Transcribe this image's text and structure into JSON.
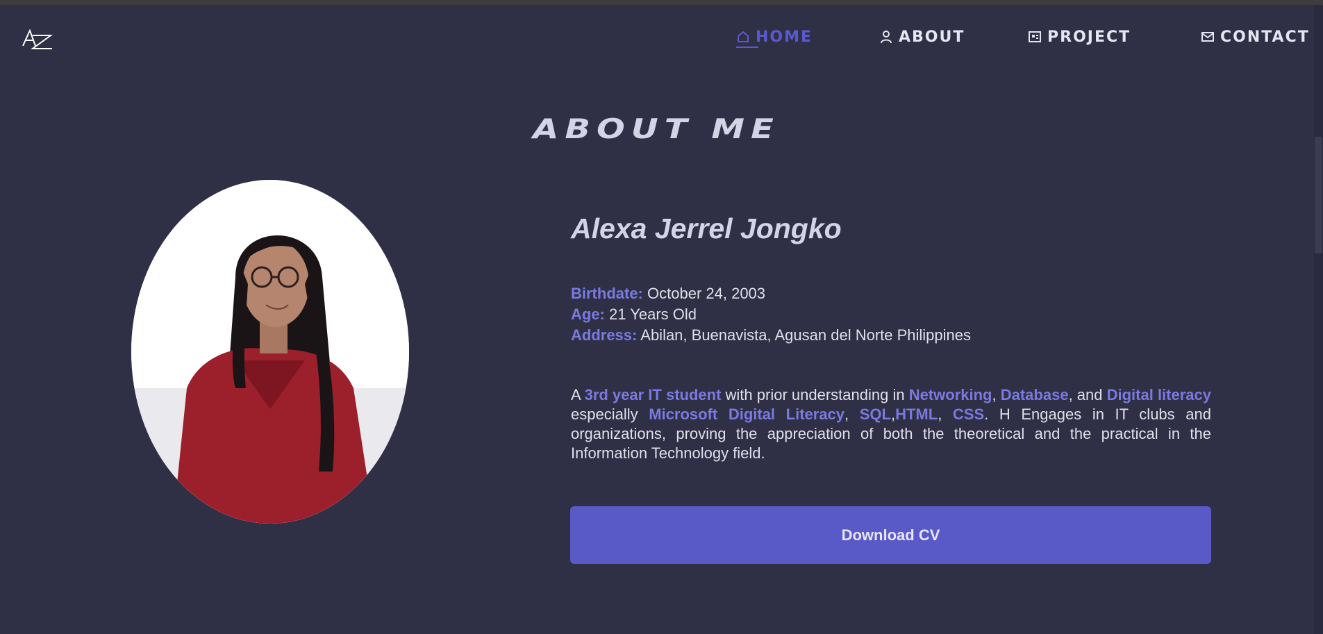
{
  "logo": {
    "text": "AZ"
  },
  "nav": {
    "items": [
      {
        "label": "HOME",
        "icon": "home-icon",
        "active": true
      },
      {
        "label": "ABOUT",
        "icon": "user-icon",
        "active": false
      },
      {
        "label": "PROJECT",
        "icon": "project-icon",
        "active": false
      },
      {
        "label": "CONTACT",
        "icon": "mail-icon",
        "active": false
      }
    ]
  },
  "section": {
    "title": "ABOUT ME"
  },
  "profile": {
    "name": "Alexa Jerrel Jongko",
    "birthdate_label": "Birthdate:",
    "birthdate": "October 24, 2003",
    "age_label": "Age:",
    "age": "21 Years Old",
    "address_label": "Address:",
    "address": "Abilan, Buenavista, Agusan del Norte Philippines"
  },
  "bio": {
    "p1": "A ",
    "h1": "3rd year IT student",
    "p2": " with prior understanding in ",
    "h2": "Networking",
    "p3": ", ",
    "h3": "Database",
    "p4": ", and ",
    "h4": "Digital literacy",
    "p5": " especially ",
    "h5": "Microsoft Digital Literacy",
    "p6": ", ",
    "h6": "SQL",
    "p7": ",",
    "h7": "HTML",
    "p8": ", ",
    "h8": "CSS",
    "p9": ". H Engages in IT clubs and organizations, proving the appreciation of both the theoretical and the practical in the Information Technology field."
  },
  "actions": {
    "download_cv": "Download CV"
  },
  "colors": {
    "background": "#2f2f45",
    "accent": "#5a5ad0",
    "highlight": "#7a7ae0",
    "button": "#5959c8"
  }
}
